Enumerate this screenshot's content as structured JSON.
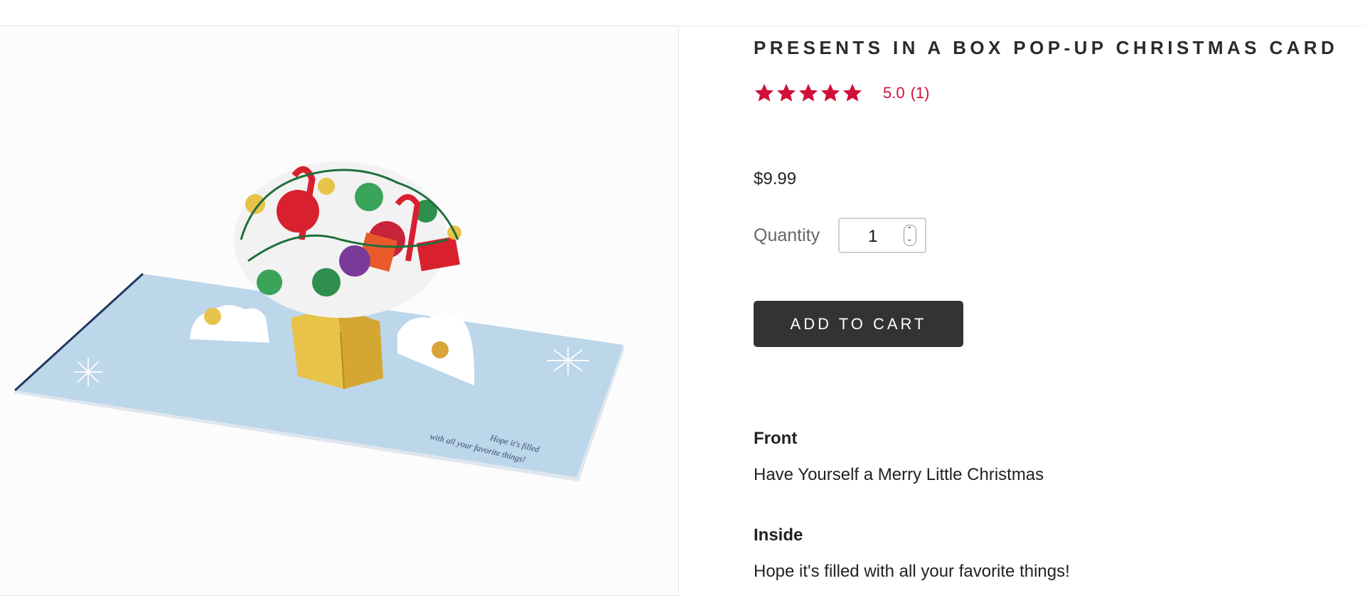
{
  "product": {
    "title": "PRESENTS IN A BOX POP-UP CHRISTMAS CARD",
    "rating": {
      "stars": 5,
      "value": "5.0",
      "count": "(1)",
      "color": "#d0103a"
    },
    "price": "$9.99",
    "quantity": {
      "label": "Quantity",
      "value": "1"
    },
    "add_to_cart_label": "ADD TO CART",
    "details": {
      "front_label": "Front",
      "front_text": "Have Yourself a Merry Little Christmas",
      "inside_label": "Inside",
      "inside_text": "Hope it's filled with all your favorite things!"
    },
    "image": {
      "card_message_line1": "Hope it's filled",
      "card_message_line2": "with all your favorite things!"
    }
  },
  "colors": {
    "button_bg": "#333333",
    "card_blue": "#bcd6ea",
    "gold": "#e8c34a"
  }
}
